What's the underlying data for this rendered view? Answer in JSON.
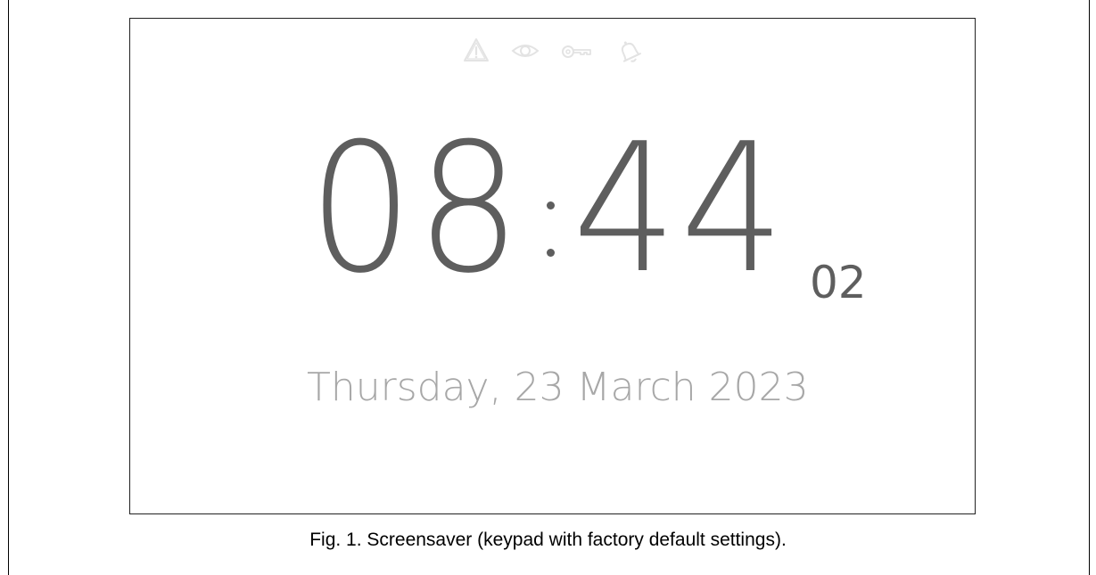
{
  "screen": {
    "status_icons": [
      {
        "name": "alarm-warning-icon",
        "color": "#e3e3e3"
      },
      {
        "name": "eye-icon",
        "color": "#e3e3e3"
      },
      {
        "name": "key-icon",
        "color": "#e3e3e3"
      },
      {
        "name": "bell-icon",
        "color": "#e3e3e3"
      }
    ],
    "time": {
      "hours": "08",
      "minutes": "44",
      "seconds": "02"
    },
    "date": "Thursday, 23 March 2023",
    "colors": {
      "clock": "#5e5e5e",
      "date": "#a7a7a7",
      "background": "#ffffff"
    }
  },
  "caption": "Fig. 1. Screensaver (keypad with factory default settings)."
}
